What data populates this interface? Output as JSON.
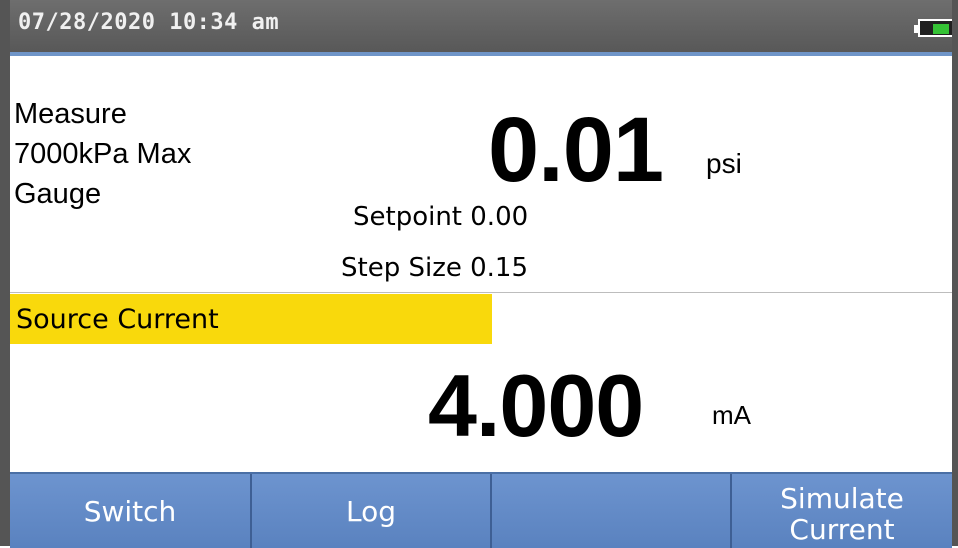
{
  "status_bar": {
    "datetime": "07/28/2020 10:34 am",
    "battery_level": 0.6,
    "battery_color": "#35c235"
  },
  "primary": {
    "mode": "Measure",
    "range": "7000kPa Max",
    "type": "Gauge",
    "value": "0.01",
    "unit": "psi",
    "setpoint": "Setpoint 0.00",
    "step_size": "Step Size 0.15"
  },
  "secondary": {
    "label": "Source Current",
    "value": "4.000",
    "unit": "mA",
    "highlight_color": "#f9d90c"
  },
  "softkeys": {
    "key1": "Switch",
    "key2": "Log",
    "key3": "",
    "key4_line1": "Simulate",
    "key4_line2": "Current"
  }
}
